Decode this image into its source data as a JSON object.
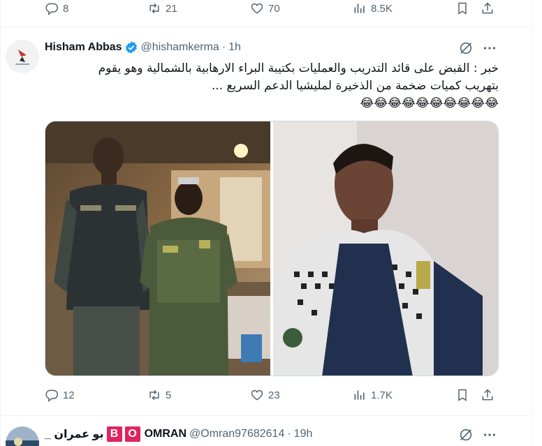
{
  "prev_tweet": {
    "actions": {
      "replies": "8",
      "retweets": "21",
      "likes": "70",
      "views": "8.5K"
    }
  },
  "tweet": {
    "author_name": "Hisham Abbas",
    "handle": "@hishamkerma",
    "separator": "·",
    "time": "1h",
    "text_line1": "خبر : القبض على قائد التدريب والعمليات بكتيبة البراء الارهابية بالشمالية وهو يقوم",
    "text_line2": "بتهريب كميات ضخمة من الذخيرة لمليشيا الدعم السريع ...",
    "emojis": "😂😂😂😂😂😂😂😂😂😂",
    "actions": {
      "replies": "12",
      "retweets": "5",
      "likes": "23",
      "views": "1.7K"
    }
  },
  "next_tweet": {
    "author_name_arabic": "بو عمران _",
    "badge1": "B",
    "badge2": "O",
    "author_name": "OMRAN",
    "handle": "@Omran97682614",
    "separator": "·",
    "time": "19h"
  },
  "colors": {
    "text": "#0f1419",
    "secondary": "#536471",
    "verified": "#1d9bf0",
    "divider": "#eff3f4"
  }
}
